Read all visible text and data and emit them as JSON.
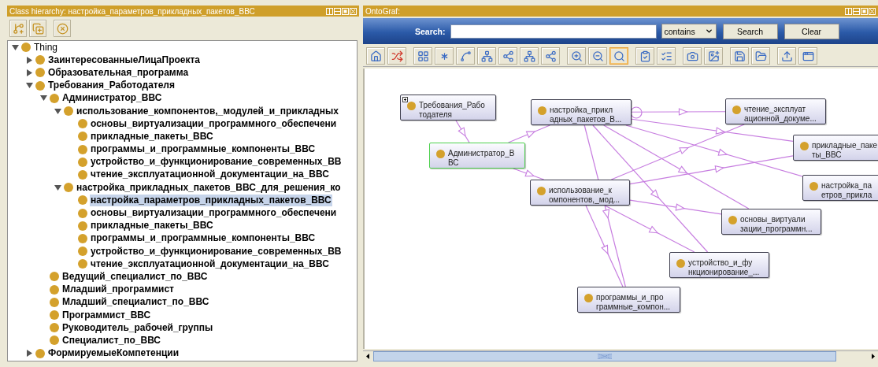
{
  "class_hierarchy": {
    "title": "Class hierarchy: настройка_параметров_прикладных_пакетов_ВВС",
    "tree": [
      {
        "label": "Thing",
        "expanded": true,
        "selected": false,
        "children": [
          {
            "label": "ЗаинтересованныеЛицаПроекта",
            "expanded": false,
            "selected": false
          },
          {
            "label": "Образовательная_программа",
            "expanded": false,
            "selected": false
          },
          {
            "label": "Требования_Работодателя",
            "expanded": true,
            "selected": false,
            "children": [
              {
                "label": "Администратор_ВВС",
                "expanded": true,
                "selected": false,
                "children": [
                  {
                    "label": "использование_компонентов,_модулей_и_прикладных",
                    "expanded": true,
                    "selected": false,
                    "children": [
                      {
                        "label": "основы_виртуализации_программного_обеспечени",
                        "selected": false
                      },
                      {
                        "label": "прикладные_пакеты_ВВС",
                        "selected": false
                      },
                      {
                        "label": "программы_и_программные_компоненты_ВВС",
                        "selected": false
                      },
                      {
                        "label": "устройство_и_функционирование_современных_ВВ",
                        "selected": false
                      },
                      {
                        "label": "чтение_эксплуатационной_документации_на_ВВС",
                        "selected": false
                      }
                    ]
                  },
                  {
                    "label": "настройка_прикладных_пакетов_ВВС_для_решения_ко",
                    "expanded": true,
                    "selected": false,
                    "children": [
                      {
                        "label": "настройка_параметров_прикладных_пакетов_ВВС",
                        "selected": true
                      },
                      {
                        "label": "основы_виртуализации_программного_обеспечени",
                        "selected": false
                      },
                      {
                        "label": "прикладные_пакеты_ВВС",
                        "selected": false
                      },
                      {
                        "label": "программы_и_программные_компоненты_ВВС",
                        "selected": false
                      },
                      {
                        "label": "устройство_и_функционирование_современных_ВВ",
                        "selected": false
                      },
                      {
                        "label": "чтение_эксплуатационной_документации_на_ВВС",
                        "selected": false
                      }
                    ]
                  }
                ]
              },
              {
                "label": "Ведущий_специалист_по_ВВС",
                "selected": false
              },
              {
                "label": "Младший_программист",
                "selected": false
              },
              {
                "label": "Младший_специалист_по_ВВС",
                "selected": false
              },
              {
                "label": "Программист_ВВС",
                "selected": false
              },
              {
                "label": "Руководитель_рабочей_группы",
                "selected": false
              },
              {
                "label": "Специалист_по_ВВС",
                "selected": false
              }
            ]
          },
          {
            "label": "ФормируемыеКомпетенции",
            "expanded": false,
            "selected": false
          }
        ]
      }
    ]
  },
  "ontograf": {
    "title": "OntoGraf:",
    "search": {
      "label": "Search:",
      "mode": "contains",
      "search_button": "Search",
      "clear_button": "Clear"
    },
    "toolbar": [
      {
        "selected": false
      },
      {
        "selected": false
      },
      {
        "selected": false
      },
      {
        "selected": false
      },
      {
        "selected": false
      },
      {
        "selected": false
      },
      {
        "selected": false
      },
      {
        "selected": false
      },
      {
        "selected": false
      },
      {
        "selected": false
      },
      {
        "selected": false
      },
      {
        "selected": true
      },
      {
        "selected": false
      },
      {
        "selected": false
      },
      {
        "selected": false
      },
      {
        "selected": false
      },
      {
        "selected": false
      },
      {
        "selected": false
      },
      {
        "selected": false
      },
      {
        "selected": false
      }
    ],
    "nodes": [
      {
        "lines": [
          "Требования_Рабо",
          "тодателя"
        ],
        "selected": false,
        "expandable": true
      },
      {
        "lines": [
          "настройка_прикл",
          "адных_пакетов_В..."
        ],
        "selected": false,
        "expandable": false
      },
      {
        "lines": [
          "Администратор_В",
          "ВС"
        ],
        "selected": true,
        "expandable": false
      },
      {
        "lines": [
          "использование_к",
          "омпонентов,_мод..."
        ],
        "selected": false,
        "expandable": false
      },
      {
        "lines": [
          "чтение_эксплуат",
          "ационной_докуме..."
        ],
        "selected": false,
        "expandable": false
      },
      {
        "lines": [
          "прикладные_паке",
          "ты_ВВС"
        ],
        "selected": false,
        "expandable": false
      },
      {
        "lines": [
          "настройка_па",
          "етров_прикла"
        ],
        "selected": false,
        "expandable": false
      },
      {
        "lines": [
          "основы_виртуали",
          "зации_программн..."
        ],
        "selected": false,
        "expandable": false
      },
      {
        "lines": [
          "устройство_и_фу",
          "нкционирование_..."
        ],
        "selected": false,
        "expandable": false
      },
      {
        "lines": [
          "программы_и_про",
          "граммные_компон..."
        ],
        "selected": false,
        "expandable": false
      }
    ]
  }
}
